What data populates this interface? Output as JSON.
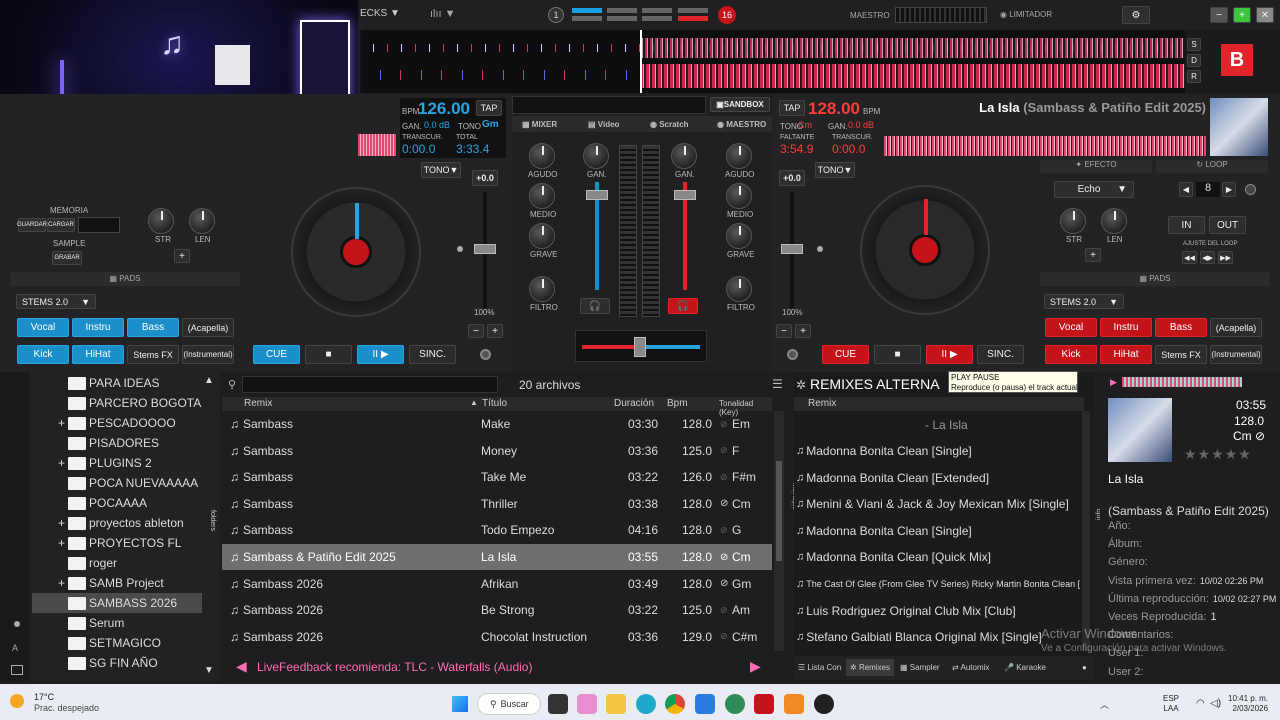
{
  "top": {
    "decks_label": "ECKS",
    "deck_num": "1",
    "maestro": "MAESTRO",
    "limitador": "LIMITADOR",
    "deck_badge": "16",
    "logo": "B",
    "sdr": [
      "S",
      "D",
      "R"
    ]
  },
  "left_deck": {
    "bpm_label": "BPM",
    "bpm": "126.00",
    "tap": "TAP",
    "gan_label": "GAN.",
    "gan": "0.0 dB",
    "tono_label": "TONO",
    "key": "Gm",
    "transcur_label": "TRANSCUR.",
    "transcur": "0:00.0",
    "total_label": "TOTAL",
    "total": "3:33.4",
    "tono_btn": "TONO",
    "pitch": "+0.0",
    "pitch_pct": "100%",
    "memoria": "MEMORIA",
    "guardar": "GUARDAR",
    "cargar": "CARGAR",
    "sample": "SAMPLE",
    "grabar": "GRABAR",
    "str": "STR",
    "len": "LEN",
    "pads": "PADS",
    "stems": "STEMS 2.0",
    "pad_buttons": [
      "Vocal",
      "Instru",
      "Bass",
      "(Acapella)",
      "Kick",
      "HiHat",
      "Stems FX",
      "(Instrumental)"
    ],
    "cue": "CUE",
    "stop": "■",
    "play": "II ▶",
    "sync": "SINC."
  },
  "mixer": {
    "sandbox": "SANDBOX",
    "tabs": [
      "MIXER",
      "Video",
      "Scratch",
      "MAESTRO"
    ],
    "knobs": [
      "AGUDO",
      "MEDIO",
      "GRAVE",
      "FILTRO",
      "GAN.",
      "GAN.",
      "AGUDO",
      "MEDIO",
      "GRAVE",
      "FILTRO"
    ]
  },
  "right_deck": {
    "tap": "TAP",
    "bpm": "128.00",
    "bpm_label": "BPM",
    "tono_label": "TONO",
    "key": "Cm",
    "gan_label": "GAN.",
    "gan": "0.0 dB",
    "faltante_label": "FALTANTE",
    "faltante": "3:54.9",
    "transcur_label": "TRANSCUR.",
    "transcur": "0:00.0",
    "title": "La Isla",
    "subtitle": "(Sambass & Patiño Edit 2025)",
    "tono_btn": "TONO",
    "pitch": "+0.0",
    "pitch_pct": "100%",
    "efecto": "EFECTO",
    "effect": "Echo",
    "str": "STR",
    "len": "LEN",
    "loop": "LOOP",
    "loop_val": "8",
    "in": "IN",
    "out": "OUT",
    "ajuste": "AJUSTE DEL LOOP",
    "pads": "PADS",
    "stems": "STEMS 2.0",
    "pad_buttons": [
      "Vocal",
      "Instru",
      "Bass",
      "(Acapella)",
      "Kick",
      "HiHat",
      "Stems FX",
      "(Instrumental)"
    ],
    "cue": "CUE",
    "stop": "■",
    "play": "II ▶",
    "sync": "SINC.",
    "tooltip_title": "PLAY PAUSE",
    "tooltip_text": "Reproduce (o pausa) el track actual"
  },
  "browser": {
    "folders": [
      {
        "name": "PARA IDEAS",
        "plus": false
      },
      {
        "name": "PARCERO BOGOTA",
        "plus": false
      },
      {
        "name": "PESCADOOOO",
        "plus": true
      },
      {
        "name": "PISADORES",
        "plus": false
      },
      {
        "name": "PLUGINS 2",
        "plus": true
      },
      {
        "name": "POCA NUEVAAAAA",
        "plus": false
      },
      {
        "name": "POCAAAA",
        "plus": false
      },
      {
        "name": "proyectos ableton",
        "plus": true
      },
      {
        "name": "PROYECTOS FL",
        "plus": true
      },
      {
        "name": "roger",
        "plus": false
      },
      {
        "name": "SAMB Project",
        "plus": true
      },
      {
        "name": "SAMBASS 2026",
        "plus": false
      },
      {
        "name": "Serum",
        "plus": false
      },
      {
        "name": "SETMAGICO",
        "plus": false
      },
      {
        "name": "SG FIN AÑO",
        "plus": false
      }
    ],
    "folders_side": "folders",
    "file_count": "20 archivos",
    "columns": [
      "Remix",
      "Título",
      "Duración",
      "Bpm",
      "Tonalidad (Key)"
    ],
    "tracks": [
      {
        "remix": "Sambass",
        "title": "Make",
        "dur": "03:30",
        "bpm": "128.0",
        "key": "Em",
        "check": false
      },
      {
        "remix": "Sambass",
        "title": "Money",
        "dur": "03:36",
        "bpm": "125.0",
        "key": "F",
        "check": false
      },
      {
        "remix": "Sambass",
        "title": "Take Me",
        "dur": "03:22",
        "bpm": "126.0",
        "key": "F#m",
        "check": false
      },
      {
        "remix": "Sambass",
        "title": "Thriller",
        "dur": "03:38",
        "bpm": "128.0",
        "key": "Cm",
        "check": true
      },
      {
        "remix": "Sambass",
        "title": "Todo Empezo",
        "dur": "04:16",
        "bpm": "128.0",
        "key": "G",
        "check": false
      },
      {
        "remix": "Sambass & Patiño Edit 2025",
        "title": "La Isla",
        "dur": "03:55",
        "bpm": "128.0",
        "key": "Cm",
        "check": true
      },
      {
        "remix": "Sambass 2026",
        "title": "Afrikan",
        "dur": "03:49",
        "bpm": "128.0",
        "key": "Gm",
        "check": true
      },
      {
        "remix": "Sambass 2026",
        "title": "Be Strong",
        "dur": "03:22",
        "bpm": "125.0",
        "key": "Am",
        "check": false
      },
      {
        "remix": "Sambass 2026",
        "title": "Chocolat Instruction",
        "dur": "03:36",
        "bpm": "129.0",
        "key": "C#m",
        "check": false
      }
    ],
    "feedback": "LiveFeedback recomienda: TLC - Waterfalls (Audio)"
  },
  "remixes": {
    "title": "REMIXES ALTERNA",
    "column": "Remix",
    "header_row": "- La Isla",
    "sideview": "sideview",
    "items": [
      "Madonna Bonita Clean [Single]",
      "Madonna Bonita Clean [Extended]",
      "Menini & Viani & Jack & Joy Mexican Mix [Single]",
      "Madonna Bonita Clean [Single]",
      "Madonna Bonita Clean [Quick Mix]",
      "The Cast Of Glee (From Glee TV Series) Ricky Martin Bonita Clean [Single]",
      "Luis Rodriguez Original Club Mix [Club]",
      "Stefano Galbiati Blanca Original Mix [Single]"
    ],
    "tabs": [
      "Lista Con",
      "Remixes",
      "Sampler",
      "Automix",
      "Karaoke"
    ]
  },
  "info": {
    "duration": "03:55",
    "bpm": "128.0",
    "key": "Cm",
    "title": "La Isla",
    "subtitle": "(Sambass & Patiño Edit 2025)",
    "side": "info",
    "fields": [
      {
        "label": "Año:",
        "value": ""
      },
      {
        "label": "Álbum:",
        "value": ""
      },
      {
        "label": "Género:",
        "value": ""
      },
      {
        "label": "Vista primera vez:",
        "value": "10/02 02:26 PM"
      },
      {
        "label": "Última reproducción:",
        "value": "10/02 02:27 PM"
      },
      {
        "label": "Veces Reproducida:",
        "value": "1"
      },
      {
        "label": "Comentarios:",
        "value": ""
      },
      {
        "label": "User 1:",
        "value": ""
      },
      {
        "label": "User 2:",
        "value": ""
      }
    ],
    "activate1": "Activar Windows",
    "activate2": "Ve a Configuración para activar Windows."
  },
  "taskbar": {
    "temp": "17°C",
    "weather": "Prac. despejado",
    "search": "Buscar",
    "lang1": "ESP",
    "lang2": "LAA",
    "time": "10:41 p. m.",
    "date": "2/03/2026"
  },
  "colors": {
    "blue": "#1a8fc9",
    "red": "#c4141a",
    "accent": "#ff3b3b"
  }
}
